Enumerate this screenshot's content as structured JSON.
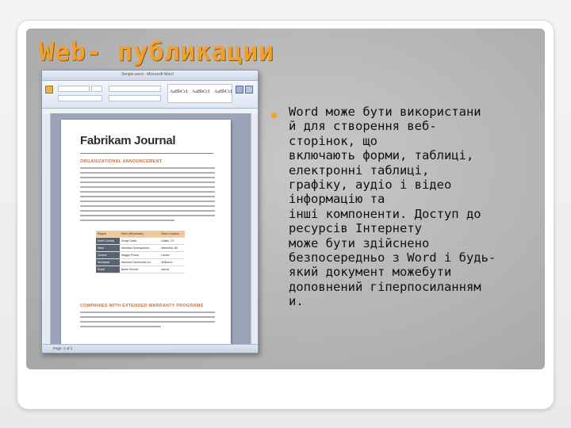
{
  "slide": {
    "title": "Web- публикации",
    "bullet": "Word може бути використани\nй для створення веб-\nсторінок, що\nвключають форми, таблиці,\nелектронні таблиці,\nграфіку, аудіо і відео\nінформацію та\nінші компоненти. Доступ до\nресурсів Інтернету\nможе бути здійснено\nбезпосередньо з Word і будь-\nякий документ можебути\nдоповнений гіперпосиланням\nи."
  },
  "screenshot": {
    "window_title": "Simple-word - Microsoft Word",
    "doc_title": "Fabrikam Journal",
    "heading_1": "ORGANIZATIONAL ANNOUNCEMENT",
    "heading_2": "COMPANIES WITH EXTENDED WARRANTY PROGRAMS",
    "styles": [
      "AaBbCcI",
      "AaBbCcI",
      "AaBbCcI"
    ],
    "table_header": [
      "Region",
      "Store (Wholesale)",
      "Store Location"
    ],
    "table_rows": [
      [
        "North Central",
        "Zenge Sales",
        "Dallas, TX"
      ],
      [
        "West",
        "Hamilton Development",
        "Winnetka, WI"
      ],
      [
        "Central",
        "Maggio Phone",
        "Lander"
      ],
      [
        "Northeast",
        "Advance Electronics Inc.",
        "Millborne"
      ],
      [
        "South",
        "Barrie Electric",
        "Azusa"
      ]
    ],
    "status_text": "Page: 1 of 2"
  },
  "colors": {
    "accent": "#f0a030",
    "heading_orange": "#d0703a"
  }
}
